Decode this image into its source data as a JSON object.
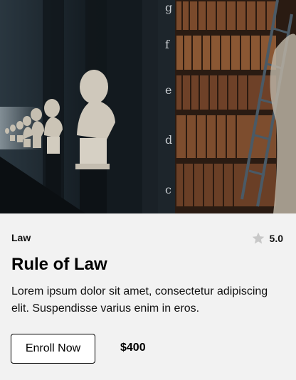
{
  "course": {
    "category": "Law",
    "rating": "5.0",
    "title": "Rule of Law",
    "description": "Lorem ipsum dolor sit amet, consectetur adipiscing elit. Suspendisse varius enim in eros.",
    "enroll_label": "Enroll Now",
    "price": "$400"
  },
  "image": {
    "shelf_letters": [
      "g",
      "f",
      "e",
      "d",
      "c"
    ]
  },
  "colors": {
    "card_background": "#f2f2f2",
    "star": "#c8c8c8",
    "button_border": "#000000"
  },
  "icons": {
    "rating": "star-icon"
  }
}
